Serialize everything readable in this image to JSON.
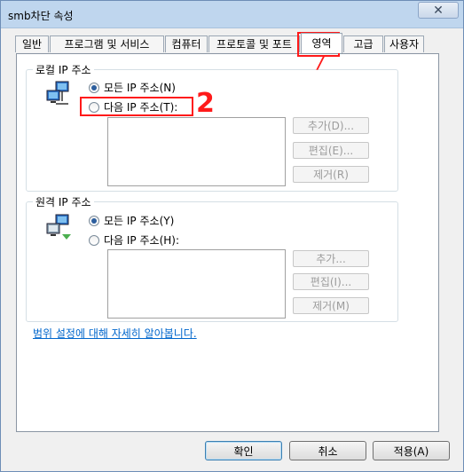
{
  "window": {
    "title": "smb차단 속성",
    "close_glyph": "✕"
  },
  "tabs": [
    {
      "label": "일반"
    },
    {
      "label": "프로그램 및 서비스"
    },
    {
      "label": "컴퓨터"
    },
    {
      "label": "프로토콜 및 포트"
    },
    {
      "label": "영역",
      "active": true
    },
    {
      "label": "고급"
    },
    {
      "label": "사용자"
    }
  ],
  "local_group": {
    "title": "로컬 IP 주소",
    "option_any": "모든 IP 주소(N)",
    "option_these": "다음 IP 주소(T):",
    "selected": "option_any",
    "buttons": {
      "add": "추가(D)...",
      "edit": "편집(E)...",
      "remove": "제거(R)"
    }
  },
  "remote_group": {
    "title": "원격 IP 주소",
    "option_any": "모든 IP 주소(Y)",
    "option_these": "다음 IP 주소(H):",
    "selected": "option_any",
    "buttons": {
      "add": "추가...",
      "edit": "편집(I)...",
      "remove": "제거(M)"
    }
  },
  "help_link": "범위 설정에 대해 자세히 알아봅니다.",
  "footer": {
    "ok": "확인",
    "cancel": "취소",
    "apply": "적용(A)"
  },
  "annotations": {
    "mark_1": "/",
    "mark_2": "2",
    "color": "#ff1a1a"
  },
  "icons": {
    "network": "network-computers-icon",
    "radio": "radio-button"
  }
}
